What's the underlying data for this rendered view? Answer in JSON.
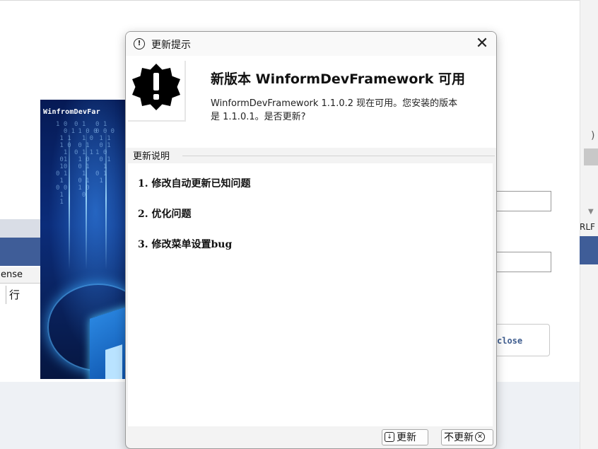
{
  "background": {
    "left_label": "ense",
    "left_cell": "行",
    "right_label": "RLF",
    "close_button": "close"
  },
  "splash": {
    "title": "WinfromDevFar"
  },
  "dialog": {
    "title": "更新提示",
    "headline": "新版本 WinformDevFramework 可用",
    "message": "WinformDevFramework 1.1.0.2 现在可用。您安装的版本是 1.1.0.1。是否更新?",
    "notes_label": "更新说明",
    "notes": [
      "1. 修改自动更新已知问题",
      "2. 优化问题",
      "3. 修改菜单设置bug"
    ],
    "update_button": "更新",
    "skip_button": "不更新"
  },
  "colors": {
    "splash_bg": "#0b2c7a",
    "bg_blue_bar": "#3f5d98",
    "close_text": "#3e5c8e"
  },
  "icons": {
    "title_icon": "info-circle-icon",
    "warning": "warning-badge-icon",
    "close": "close-icon",
    "download": "download-icon",
    "cancel": "cancel-circle-icon"
  }
}
